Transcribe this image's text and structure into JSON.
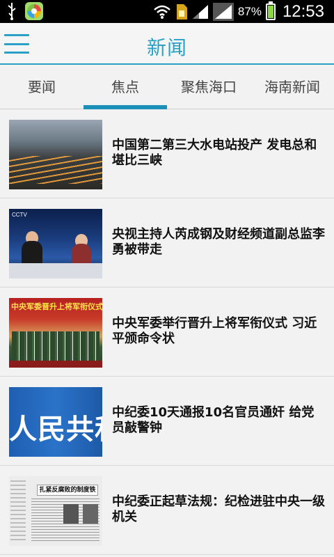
{
  "status_bar": {
    "battery_percent": "87%",
    "battery_level": 0.87,
    "time": "12:53",
    "icons": [
      "usb-icon",
      "app-icon",
      "wifi-icon",
      "sim-card-icon",
      "signal-icon",
      "signal-icon-2",
      "battery-charging-icon"
    ]
  },
  "header": {
    "title": "新闻",
    "menu_icon": "hamburger-menu-icon",
    "accent_color": "#2aa0c6"
  },
  "tabs": [
    {
      "label": "要闻",
      "active": false
    },
    {
      "label": "焦点",
      "active": true
    },
    {
      "label": "聚焦海口",
      "active": false
    },
    {
      "label": "海南新闻",
      "active": false
    }
  ],
  "news": [
    {
      "title": "中国第二第三大水电站投产 发电总和堪比三峡"
    },
    {
      "title": "央视主持人芮成钢及财经频道副总监李勇被带走",
      "thumb_text": "CCTV"
    },
    {
      "title": "中央军委举行晋升上将军衔仪式 习近平颁命令状",
      "thumb_text": "中央军委晋升上将军衔仪式"
    },
    {
      "title": "中纪委10天通报10名官员通奸 给党员敲警钟",
      "thumb_text": "人民共和"
    },
    {
      "title": "中纪委正起草法规：纪检进驻中央一级机关",
      "thumb_text": "扎紧反腐败的制度铁笼"
    }
  ]
}
